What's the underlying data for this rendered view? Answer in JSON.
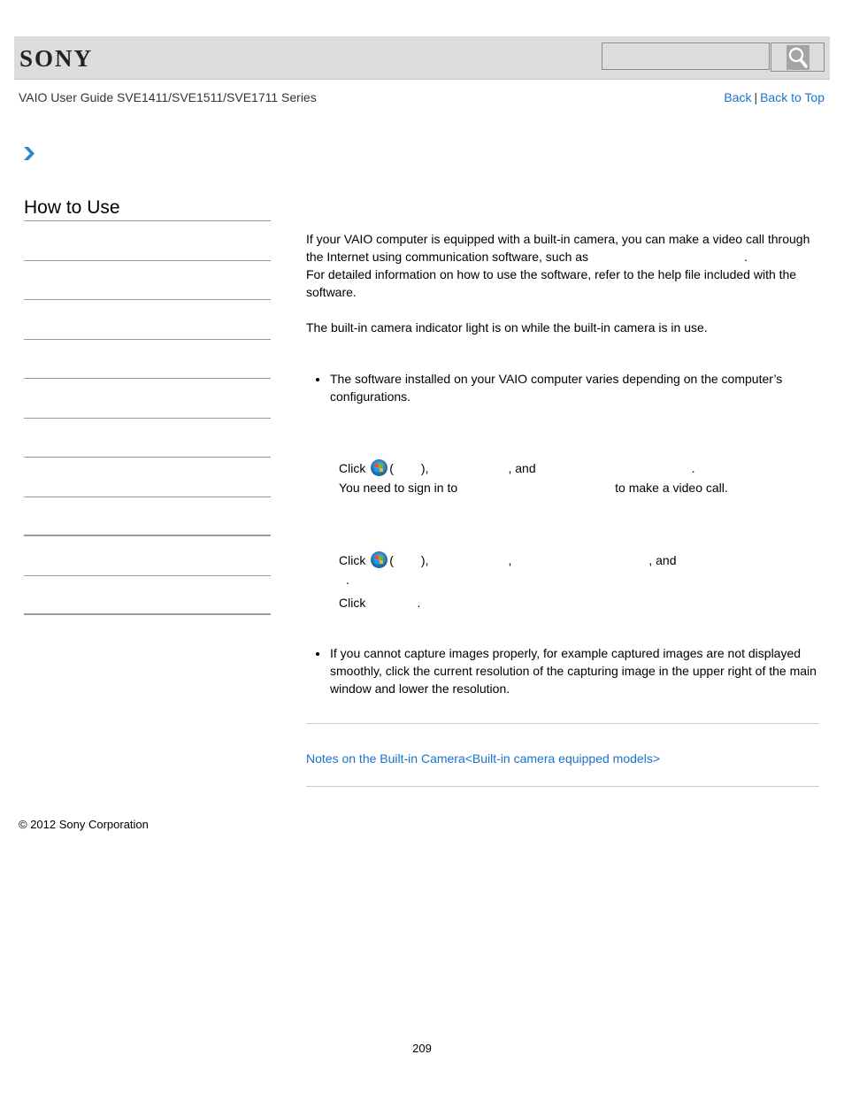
{
  "header": {
    "logo": "SONY",
    "search": {
      "placeholder": "",
      "value": ""
    },
    "search_button_icon": "magnifier-icon"
  },
  "guide_title": "VAIO User Guide SVE1411/SVE1511/SVE1711 Series",
  "topnav": {
    "back": "Back",
    "separator": "|",
    "back_to_top": "Back to Top"
  },
  "breadcrumb_icon": "chevron-right-icon",
  "sidebar": {
    "heading": "How to Use",
    "items": [
      "",
      "",
      "",
      "",
      "",
      "",
      "",
      "",
      "",
      ""
    ]
  },
  "content": {
    "intro": {
      "line1": "If your VAIO computer is equipped with a built-in camera, you can make a video call through",
      "line2_prefix": "the Internet using communication software, such as",
      "line2_suffix": ".",
      "line3": "For detailed information on how to use the software, refer to the help file included with the software."
    },
    "indicator_note": "The built-in camera indicator light is on while the built-in camera is in use.",
    "note1": "The software installed on your VAIO computer varies depending on the computer’s configurations.",
    "step_a": {
      "click": "Click",
      "open_paren": "(",
      "close_paren": "),",
      "and": ", and",
      "period": ".",
      "signin_prefix": "You need to sign in to",
      "signin_suffix": "to make a video call."
    },
    "step_b": {
      "click": "Click",
      "open_paren": "(",
      "close_paren": "),",
      "comma": ",",
      "and": ", and",
      "period": "."
    },
    "step_c": {
      "click": "Click",
      "period": "."
    },
    "note2": "If you cannot capture images properly, for example captured images are not displayed smoothly, click the current resolution of the capturing image in the upper right of the main window and lower the resolution."
  },
  "related": {
    "link": "Notes on the Built-in Camera<Built-in camera equipped models>"
  },
  "footer": {
    "copyright": "© 2012 Sony Corporation",
    "page_number": "209"
  }
}
